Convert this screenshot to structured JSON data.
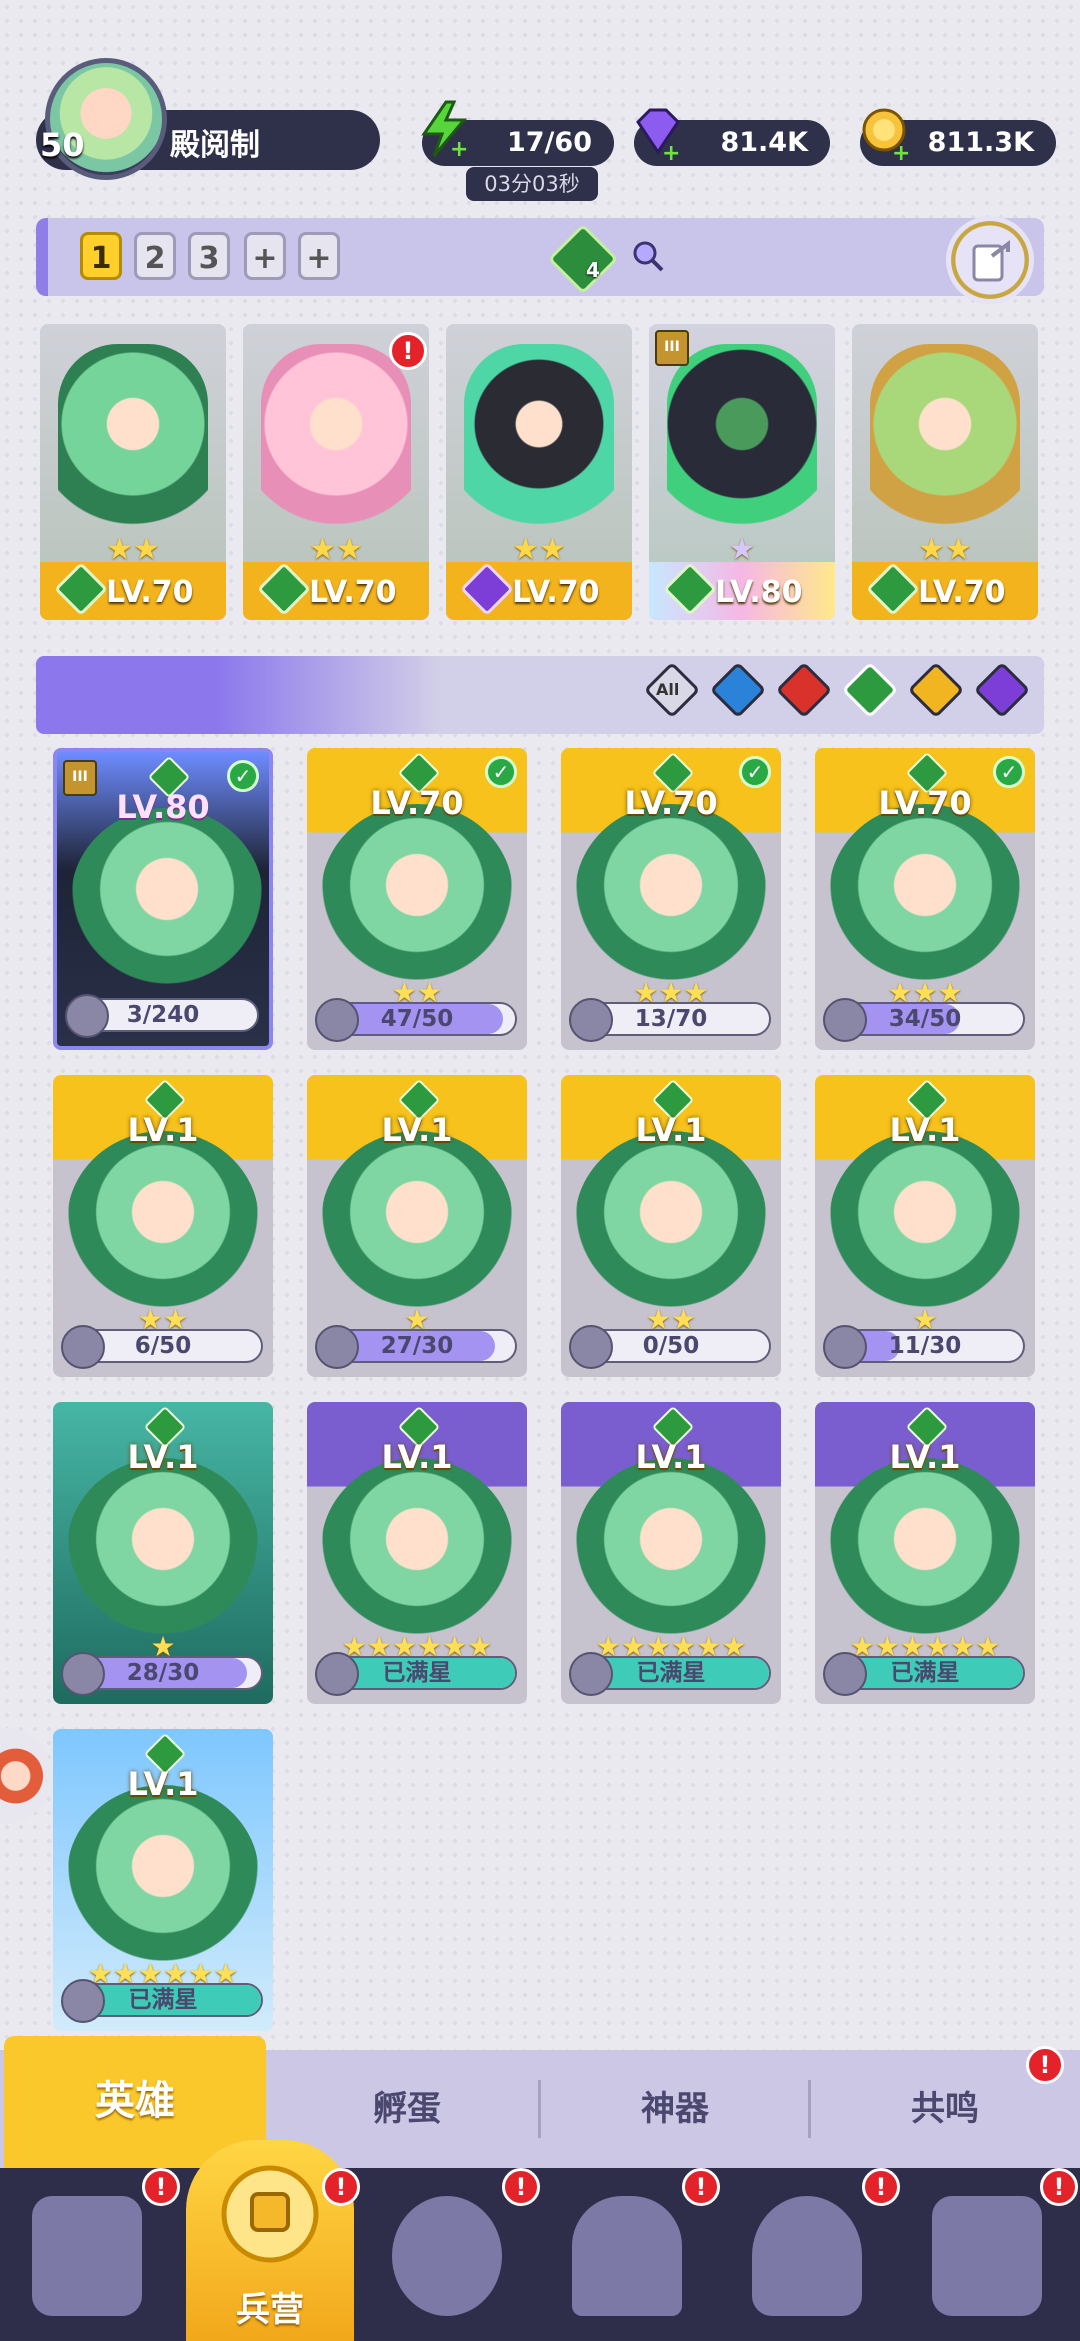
{
  "player": {
    "level": "50",
    "name": "殿阅制"
  },
  "resources": {
    "energy": "17/60",
    "energy_timer": "03分03秒",
    "gems": "81.4K",
    "coins": "811.3K"
  },
  "team": {
    "slots": [
      "1",
      "2",
      "3"
    ],
    "gem_count": "4"
  },
  "lineup": [
    {
      "level": "LV.70",
      "element": "nature",
      "stars": "★★"
    },
    {
      "level": "LV.70",
      "element": "nature",
      "stars": "★★",
      "alert": "!"
    },
    {
      "level": "LV.70",
      "element": "dark",
      "stars": "★★"
    },
    {
      "level": "LV.80",
      "element": "nature",
      "stars": "",
      "rank": "III"
    },
    {
      "level": "LV.70",
      "element": "nature",
      "stars": "★★"
    }
  ],
  "filters": {
    "all": "All"
  },
  "heroes": [
    {
      "level": "LV.80",
      "progress": "3/240",
      "fill": 0.01,
      "rank": "III"
    },
    {
      "level": "LV.70",
      "progress": "47/50",
      "fill": 0.94,
      "stars": "★★"
    },
    {
      "level": "LV.70",
      "progress": "13/70",
      "fill": 0.19,
      "stars": "★★★"
    },
    {
      "level": "LV.70",
      "progress": "34/50",
      "fill": 0.68,
      "stars": "★★★"
    },
    {
      "level": "LV.1",
      "progress": "6/50",
      "fill": 0.12,
      "stars": "★★"
    },
    {
      "level": "LV.1",
      "progress": "27/30",
      "fill": 0.9,
      "stars": "★"
    },
    {
      "level": "LV.1",
      "progress": "0/50",
      "fill": 0.0,
      "stars": "★★"
    },
    {
      "level": "LV.1",
      "progress": "11/30",
      "fill": 0.37,
      "stars": "★"
    },
    {
      "level": "LV.1",
      "progress": "28/30",
      "fill": 0.93,
      "stars": "★"
    },
    {
      "level": "LV.1",
      "progress": "已满星",
      "fill": 1.0,
      "stars": "★★★★★★"
    },
    {
      "level": "LV.1",
      "progress": "已满星",
      "fill": 1.0,
      "stars": "★★★★★★"
    },
    {
      "level": "LV.1",
      "progress": "已满星",
      "fill": 1.0,
      "stars": "★★★★★★"
    },
    {
      "level": "LV.1",
      "progress": "已满星",
      "fill": 1.0,
      "stars": "★★★★★★"
    }
  ],
  "tabs": [
    "英雄",
    "孵蛋",
    "神器",
    "共鸣"
  ],
  "nav": {
    "active_label": "兵营",
    "alert": "!"
  }
}
